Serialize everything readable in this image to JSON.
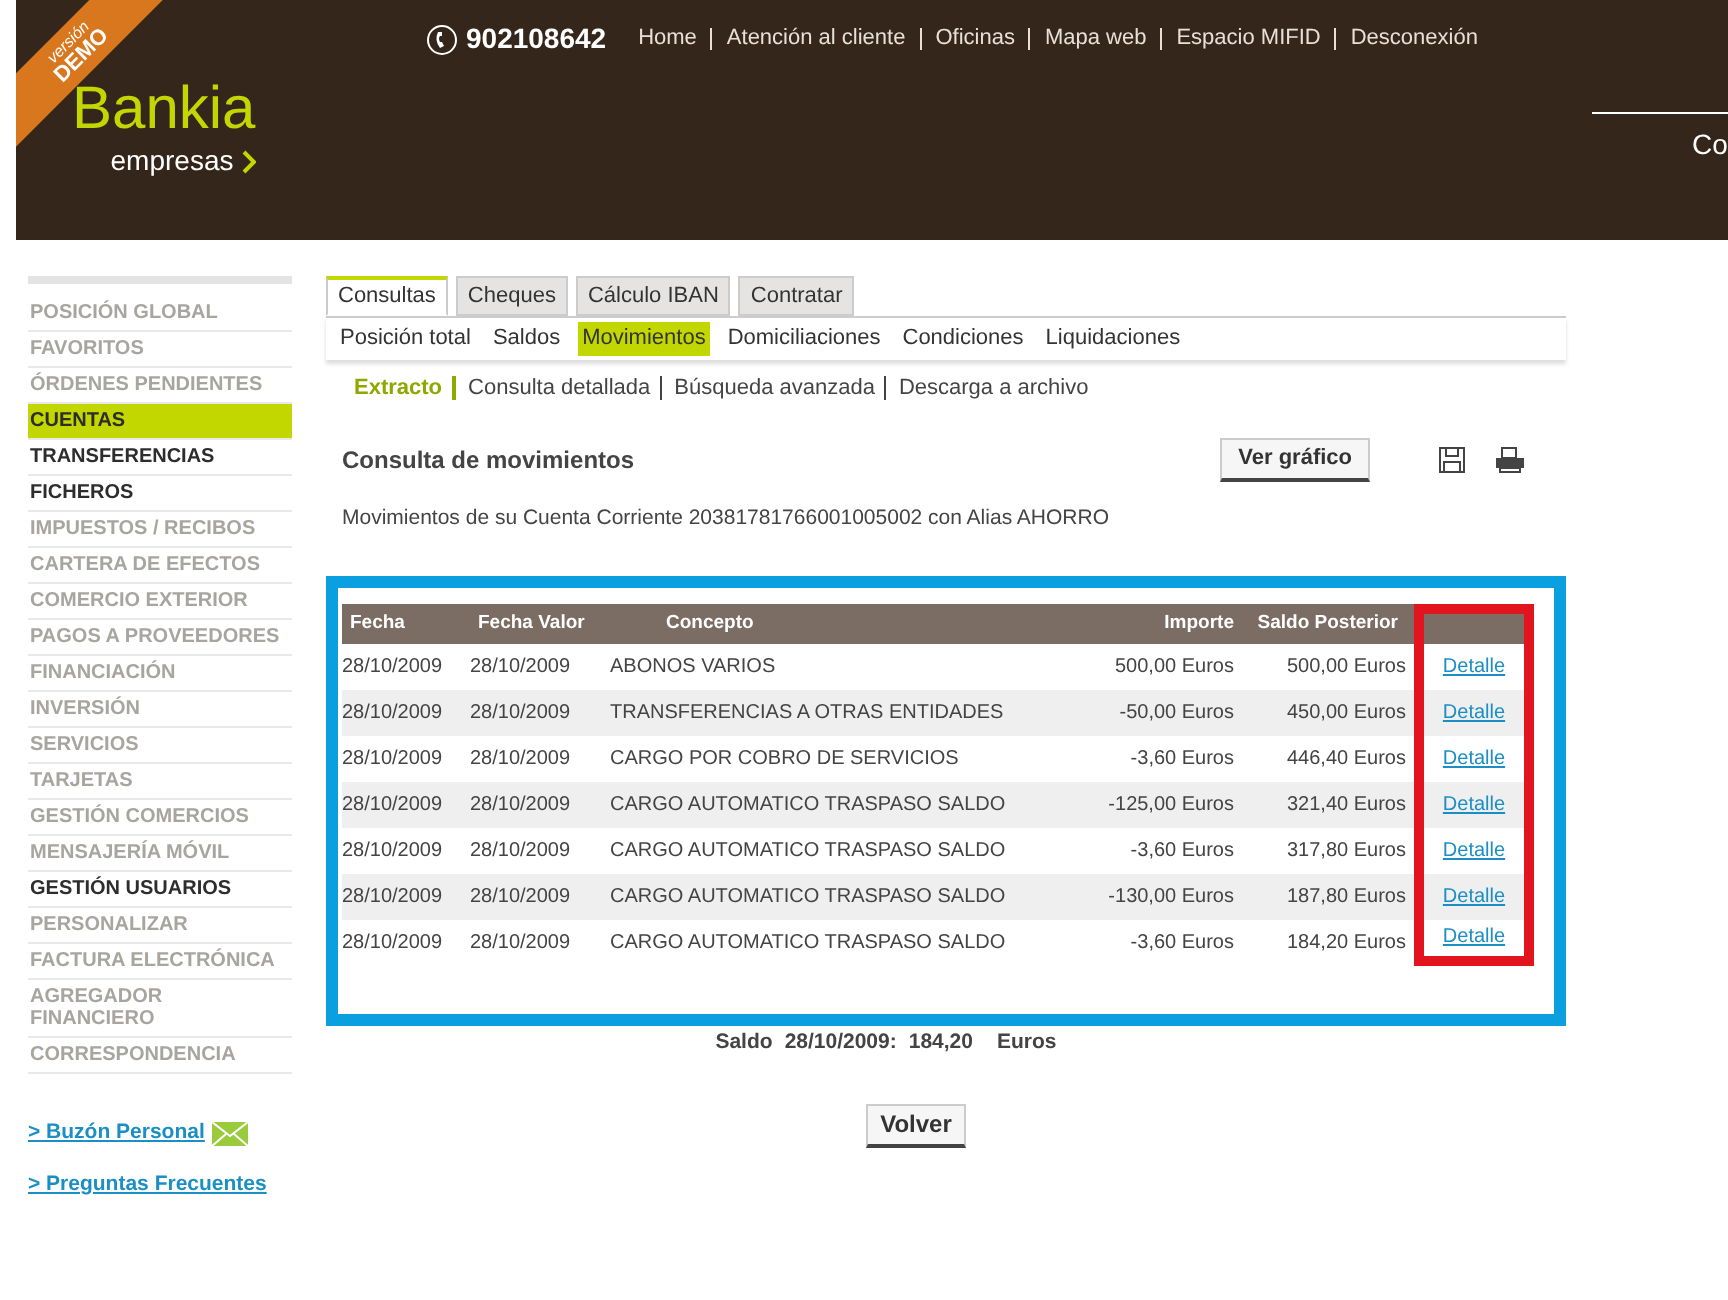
{
  "header": {
    "badge_top": "versión",
    "badge_bottom": "DEMO",
    "logo": "Bankia",
    "logo_sub": "empresas",
    "phone": "902108642",
    "links": [
      "Home",
      "Atención al cliente",
      "Oficinas",
      "Mapa web",
      "Espacio MIFID",
      "Desconexión"
    ],
    "cut_text": "Co"
  },
  "sidebar": {
    "items": [
      {
        "label": "POSICIÓN GLOBAL",
        "selected": false,
        "disabled": true
      },
      {
        "label": "FAVORITOS",
        "selected": false,
        "disabled": true
      },
      {
        "label": "ÓRDENES PENDIENTES",
        "selected": false,
        "disabled": true
      },
      {
        "label": "CUENTAS",
        "selected": true,
        "disabled": false
      },
      {
        "label": "TRANSFERENCIAS",
        "selected": false,
        "disabled": false
      },
      {
        "label": "FICHEROS",
        "selected": false,
        "disabled": false
      },
      {
        "label": "IMPUESTOS / RECIBOS",
        "selected": false,
        "disabled": true
      },
      {
        "label": "CARTERA DE EFECTOS",
        "selected": false,
        "disabled": true
      },
      {
        "label": "COMERCIO EXTERIOR",
        "selected": false,
        "disabled": true
      },
      {
        "label": "PAGOS A PROVEEDORES",
        "selected": false,
        "disabled": true
      },
      {
        "label": "FINANCIACIÓN",
        "selected": false,
        "disabled": true
      },
      {
        "label": "INVERSIÓN",
        "selected": false,
        "disabled": true
      },
      {
        "label": "SERVICIOS",
        "selected": false,
        "disabled": true
      },
      {
        "label": "TARJETAS",
        "selected": false,
        "disabled": true
      },
      {
        "label": "GESTIÓN COMERCIOS",
        "selected": false,
        "disabled": true
      },
      {
        "label": "MENSAJERÍA MÓVIL",
        "selected": false,
        "disabled": true
      },
      {
        "label": "GESTIÓN USUARIOS",
        "selected": false,
        "disabled": false
      },
      {
        "label": "PERSONALIZAR",
        "selected": false,
        "disabled": true
      },
      {
        "label": "FACTURA ELECTRÓNICA",
        "selected": false,
        "disabled": true
      },
      {
        "label": "AGREGADOR FINANCIERO",
        "selected": false,
        "disabled": true
      },
      {
        "label": "CORRESPONDENCIA",
        "selected": false,
        "disabled": true
      }
    ],
    "links": [
      {
        "label": "> Buzón Personal",
        "kind": "mail"
      },
      {
        "label": "> Preguntas Frecuentes",
        "kind": "plain"
      }
    ]
  },
  "tabs": [
    {
      "label": "Consultas",
      "selected": true
    },
    {
      "label": "Cheques",
      "selected": false
    },
    {
      "label": "Cálculo IBAN",
      "selected": false
    },
    {
      "label": "Contratar",
      "selected": false
    }
  ],
  "subtabs": [
    {
      "label": "Posición total",
      "selected": false
    },
    {
      "label": "Saldos",
      "selected": false
    },
    {
      "label": "Movimientos",
      "selected": true
    },
    {
      "label": "Domiciliaciones",
      "selected": false
    },
    {
      "label": "Condiciones",
      "selected": false
    },
    {
      "label": "Liquidaciones",
      "selected": false
    }
  ],
  "submenu": [
    {
      "label": "Extracto",
      "selected": true
    },
    {
      "label": "Consulta detallada",
      "selected": false
    },
    {
      "label": "Búsqueda avanzada",
      "selected": false
    },
    {
      "label": "Descarga a archivo",
      "selected": false
    }
  ],
  "title": "Consulta de movimientos",
  "chart_button": "Ver gráfico",
  "description": "Movimientos de su Cuenta Corriente 20381781766001005002 con Alias AHORRO",
  "table": {
    "columns": [
      "Fecha",
      "Fecha Valor",
      "Concepto",
      "Importe",
      "Saldo Posterior"
    ],
    "rows": [
      [
        "28/10/2009",
        "28/10/2009",
        "ABONOS VARIOS",
        "500,00 Euros",
        "500,00 Euros",
        "Detalle"
      ],
      [
        "28/10/2009",
        "28/10/2009",
        "TRANSFERENCIAS A OTRAS ENTIDADES",
        "-50,00 Euros",
        "450,00 Euros",
        "Detalle"
      ],
      [
        "28/10/2009",
        "28/10/2009",
        "CARGO POR COBRO DE SERVICIOS",
        "-3,60 Euros",
        "446,40 Euros",
        "Detalle"
      ],
      [
        "28/10/2009",
        "28/10/2009",
        "CARGO AUTOMATICO TRASPASO SALDO",
        "-125,00 Euros",
        "321,40 Euros",
        "Detalle"
      ],
      [
        "28/10/2009",
        "28/10/2009",
        "CARGO AUTOMATICO TRASPASO SALDO",
        "-3,60 Euros",
        "317,80 Euros",
        "Detalle"
      ],
      [
        "28/10/2009",
        "28/10/2009",
        "CARGO AUTOMATICO TRASPASO SALDO",
        "-130,00 Euros",
        "187,80 Euros",
        "Detalle"
      ],
      [
        "28/10/2009",
        "28/10/2009",
        "CARGO AUTOMATICO TRASPASO SALDO",
        "-3,60 Euros",
        "184,20 Euros",
        "Detalle"
      ]
    ]
  },
  "balance": {
    "label": "Saldo",
    "date": "28/10/2009:",
    "amount": "184,20",
    "currency": "Euros"
  },
  "back_button": "Volver"
}
